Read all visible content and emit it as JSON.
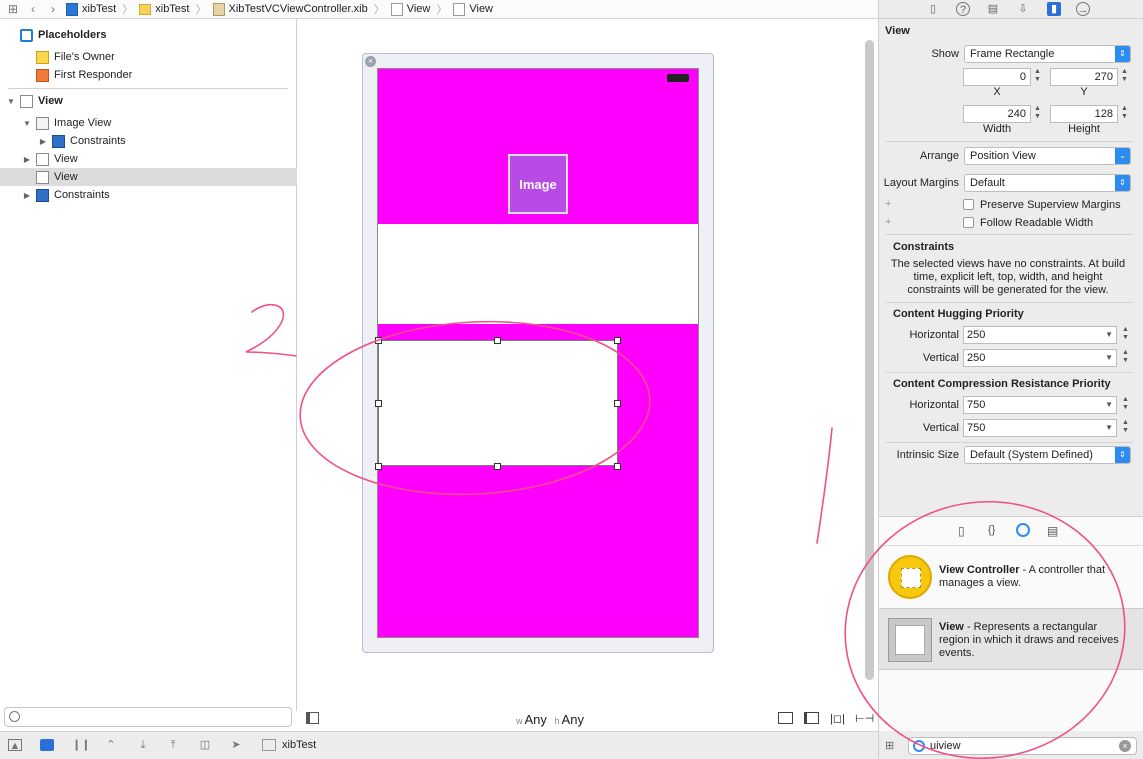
{
  "jumpbar": {
    "crumbs": [
      "xibTest",
      "xibTest",
      "XibTestVCViewController.xib",
      "View",
      "View"
    ]
  },
  "outline": {
    "placeholders": "Placeholders",
    "files_owner": "File's Owner",
    "first_responder": "First Responder",
    "root_view": "View",
    "image_view": "Image View",
    "image_constraints": "Constraints",
    "view_1": "View",
    "view_2": "View",
    "constraints": "Constraints"
  },
  "canvas": {
    "image_placeholder": "Image",
    "size_w_prefix": "w",
    "size_w": "Any",
    "size_h_prefix": "h",
    "size_h": "Any"
  },
  "bottombar": {
    "scheme": "xibTest"
  },
  "inspector": {
    "section": "View",
    "show_label": "Show",
    "show_value": "Frame Rectangle",
    "x": "0",
    "x_label": "X",
    "y": "270",
    "y_label": "Y",
    "width": "240",
    "width_label": "Width",
    "height": "128",
    "height_label": "Height",
    "arrange_label": "Arrange",
    "arrange_value": "Position View",
    "margins_label": "Layout Margins",
    "margins_value": "Default",
    "preserve_margins": "Preserve Superview Margins",
    "follow_readable": "Follow Readable Width",
    "constraints_title": "Constraints",
    "constraints_text": "The selected views have no constraints. At build time, explicit left, top, width, and height constraints will be generated for the view.",
    "hugging_title": "Content Hugging Priority",
    "hugging_h_label": "Horizontal",
    "hugging_h": "250",
    "hugging_v_label": "Vertical",
    "hugging_v": "250",
    "compression_title": "Content Compression Resistance Priority",
    "compression_h_label": "Horizontal",
    "compression_h": "750",
    "compression_v_label": "Vertical",
    "compression_v": "750",
    "intrinsic_label": "Intrinsic Size",
    "intrinsic_value": "Default (System Defined)"
  },
  "library": {
    "items": [
      {
        "name": "View Controller",
        "desc_line1": " - A controller that",
        "desc_line2": "manages a view."
      },
      {
        "name": "View",
        "desc_line1": " - Represents a rectangular",
        "desc_line2": "region in which it draws and receives",
        "desc_line3": "events."
      }
    ],
    "filter_value": "uiview"
  },
  "annotations": {
    "mark_left": "2",
    "mark_right": "1",
    "stroke_color": "#f0508a"
  },
  "colors": {
    "device_bg": "#ff00ff",
    "image_bg": "#b84ae8",
    "accent": "#2d8cf0"
  }
}
